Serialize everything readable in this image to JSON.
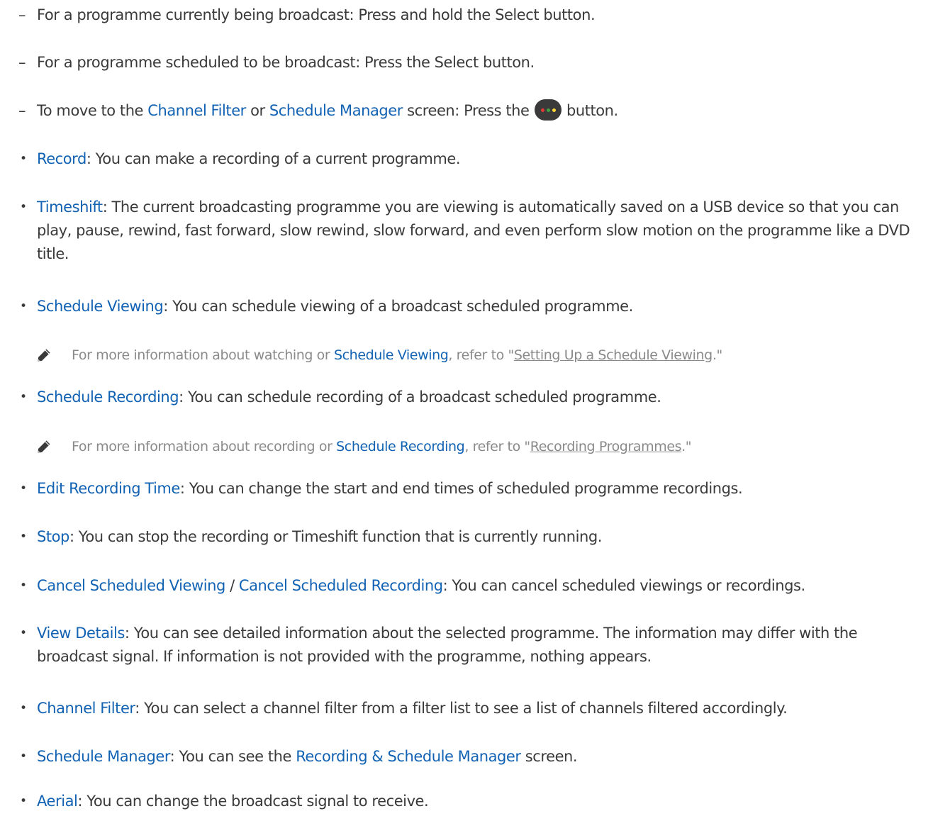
{
  "lines": {
    "l1": {
      "marker": "–",
      "text": "For a programme currently being broadcast: Press and hold the Select button."
    },
    "l2": {
      "marker": "–",
      "text": "For a programme scheduled to be broadcast: Press the Select button."
    },
    "l3": {
      "marker": "–",
      "pre": "To move to the ",
      "hl1": "Channel Filter",
      "mid": " or ",
      "hl2": "Schedule Manager",
      "post1": " screen: Press the ",
      "post2": " button."
    },
    "record": {
      "marker": "•",
      "term": "Record",
      "rest": ": You can make a recording of a current programme."
    },
    "timeshift": {
      "marker": "•",
      "term": "Timeshift",
      "rest": ": The current broadcasting programme you are viewing is automatically saved on a USB device so that you can play, pause, rewind, fast forward, slow rewind, slow forward, and even perform slow motion on the programme like a DVD title."
    },
    "schedule_viewing": {
      "marker": "•",
      "term": "Schedule Viewing",
      "rest": ": You can schedule viewing of a broadcast scheduled programme."
    },
    "schedule_recording": {
      "marker": "•",
      "term": "Schedule Recording",
      "rest": ": You can schedule recording of a broadcast scheduled programme."
    },
    "edit_recording_time": {
      "marker": "•",
      "term": "Edit Recording Time",
      "rest": ": You can change the start and end times of scheduled programme recordings."
    },
    "stop": {
      "marker": "•",
      "term": "Stop",
      "rest": ": You can stop the recording or Timeshift function that is currently running."
    },
    "cancel": {
      "marker": "•",
      "term1": "Cancel Scheduled Viewing",
      "sep": " / ",
      "term2": "Cancel Scheduled Recording",
      "rest": ": You can cancel scheduled viewings or recordings."
    },
    "view_details": {
      "marker": "•",
      "term": "View Details",
      "rest": ": You can see detailed information about the selected programme. The information may differ with the broadcast signal. If information is not provided with the programme, nothing appears."
    },
    "channel_filter": {
      "marker": "•",
      "term": "Channel Filter",
      "rest": ": You can select a channel filter from a filter list to see a list of channels filtered accordingly."
    },
    "schedule_manager": {
      "marker": "•",
      "term": "Schedule Manager",
      "mid": ": You can see the ",
      "term2": "Recording & Schedule Manager",
      "rest": " screen."
    },
    "aerial": {
      "marker": "•",
      "term": "Aerial",
      "rest": ": You can change the broadcast signal to receive."
    }
  },
  "notes": {
    "viewing": {
      "pre": "For more information about watching or ",
      "hl": "Schedule Viewing",
      "mid": ", refer to \"",
      "link": "Setting Up a Schedule Viewing",
      "post": ".\""
    },
    "recording": {
      "pre": "For more information about recording or ",
      "hl": "Schedule Recording",
      "mid": ", refer to \"",
      "link": "Recording Programmes",
      "post": ".\""
    }
  },
  "icons": {
    "pencil": "pencil-icon",
    "color_button": "color-button-icon",
    "color_button_dots": [
      "#e53935",
      "#43a047",
      "#fdd835"
    ]
  },
  "colors": {
    "highlight": "#1262b3",
    "body_text": "#3a3a3a",
    "note_text": "#8a8a8a"
  }
}
